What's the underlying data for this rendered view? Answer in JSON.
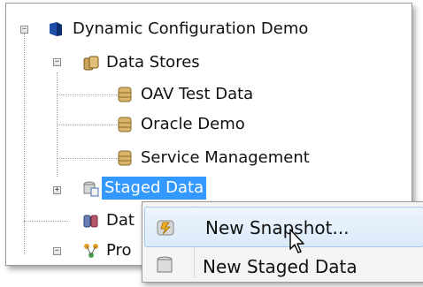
{
  "tree": {
    "root": {
      "label": "Dynamic Configuration Demo",
      "expander": "−"
    },
    "data_stores": {
      "label": "Data Stores",
      "expander": "−",
      "children": [
        "OAV Test Data",
        "Oracle Demo",
        "Service Management"
      ]
    },
    "staged_data": {
      "label": "Staged Data",
      "expander": "+"
    },
    "data_interfaces": {
      "label": "Dat"
    },
    "processes": {
      "label": "Pro",
      "expander": "−"
    }
  },
  "context_menu": {
    "items": [
      {
        "label": "New Snapshot...",
        "icon": "snapshot-icon"
      },
      {
        "label": "New Staged Data",
        "icon": "staged-data-icon"
      }
    ]
  },
  "colors": {
    "selection": "#3399ff",
    "menu_hover": "#dbeaf9"
  }
}
